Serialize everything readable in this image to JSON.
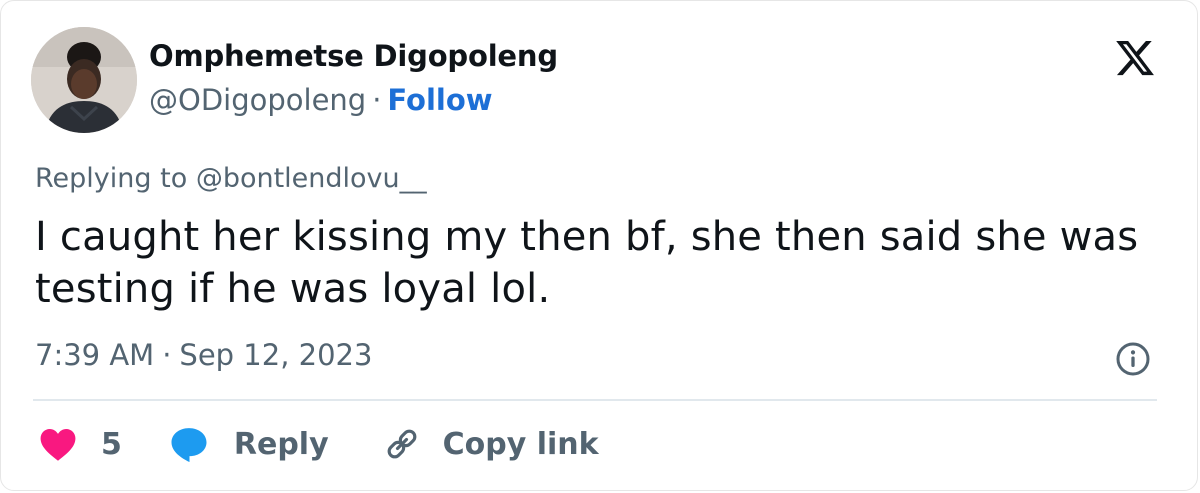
{
  "user": {
    "display_name": "Omphemetse Digopoleng",
    "handle": "@ODigopoleng",
    "separator": "·",
    "follow_label": "Follow"
  },
  "tweet": {
    "replying_prefix": "Replying to",
    "replying_to": "@bontlendlovu__",
    "text": "I caught her kissing my then bf, she then said she was testing if he was loyal lol.",
    "time": "7:39 AM",
    "separator": "·",
    "date": "Sep 12, 2023"
  },
  "actions": {
    "like_count": "5",
    "reply_label": "Reply",
    "copy_label": "Copy link"
  },
  "icons": {
    "logo": "x-logo-icon",
    "info": "info-icon",
    "like": "heart-icon",
    "reply": "speech-bubble-icon",
    "copy": "link-icon"
  },
  "colors": {
    "text": "#0f1419",
    "secondary": "#536471",
    "follow": "#1d6fd6",
    "heart": "#f91880",
    "reply_bubble": "#1d9bf0",
    "divider": "#e1e8ed"
  }
}
